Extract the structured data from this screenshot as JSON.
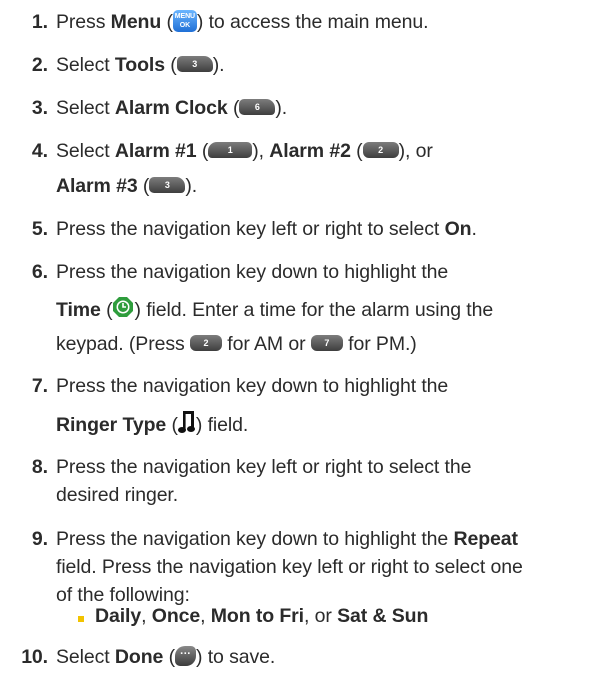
{
  "steps": [
    {
      "num": "1.",
      "lead": "Press ",
      "b1": "Menu",
      "open": " (",
      "key": "MENU\nOK",
      "tail": ") to access the main menu."
    },
    {
      "num": "2.",
      "lead": "Select ",
      "b1": "Tools",
      "open": " (",
      "key": "3",
      "tail": ")."
    },
    {
      "num": "3.",
      "lead": "Select ",
      "b1": "Alarm Clock",
      "open": " (",
      "key": "6",
      "tail": ")."
    },
    {
      "num": "4.",
      "lead": "Select ",
      "b1": "Alarm #1",
      "open": " (",
      "key1": "1",
      "mid1": "), ",
      "b2": "Alarm #2",
      "open2": " (",
      "key2": "2",
      "mid2": "), or",
      "b3": "Alarm #3",
      "open3": " (",
      "key3": "3",
      "tail": ")."
    },
    {
      "num": "5.",
      "text": "Press the navigation key left or right to select ",
      "b1": "On",
      "tail": "."
    },
    {
      "num": "6.",
      "line1": "Press the navigation key down to highlight the",
      "b1": "Time",
      "open": " (",
      "tail": ") field. Enter a time for the alarm using the",
      "line3a": "keypad. (Press ",
      "key1": "2",
      "line3b": " for AM or ",
      "key2": "7",
      "line3c": " for PM.)"
    },
    {
      "num": "7.",
      "line1": "Press the navigation key down to highlight the",
      "b1": "Ringer Type",
      "open": " (",
      "tail": ") field."
    },
    {
      "num": "8.",
      "line1": "Press the navigation key left or right to select the",
      "line2": "desired ringer."
    },
    {
      "num": "9.",
      "line1": "Press the navigation key down to highlight the ",
      "b1": "Repeat",
      "line2": "field. Press the navigation key left or right to select one",
      "line3": "of the following:",
      "opt1": "Daily",
      "sep1": ", ",
      "opt2": "Once",
      "sep2": ", ",
      "opt3": "Mon to Fri",
      "sep3": ", or ",
      "opt4": "Sat & Sun"
    },
    {
      "num": "10.",
      "lead": "Select ",
      "b1": "Done",
      "open": " (",
      "key": "···",
      "tail": ") to save."
    }
  ],
  "colors": {
    "text": "#2b2b2b",
    "bullet": "#f2c300",
    "menu_key": "#3a8ff0",
    "key_gray": "#5a5a5a",
    "time_icon": "#2e9d3c"
  },
  "icons": [
    "menu-ok-key-icon",
    "softkey-icon",
    "time-clock-icon",
    "music-note-icon",
    "done-key-icon"
  ]
}
